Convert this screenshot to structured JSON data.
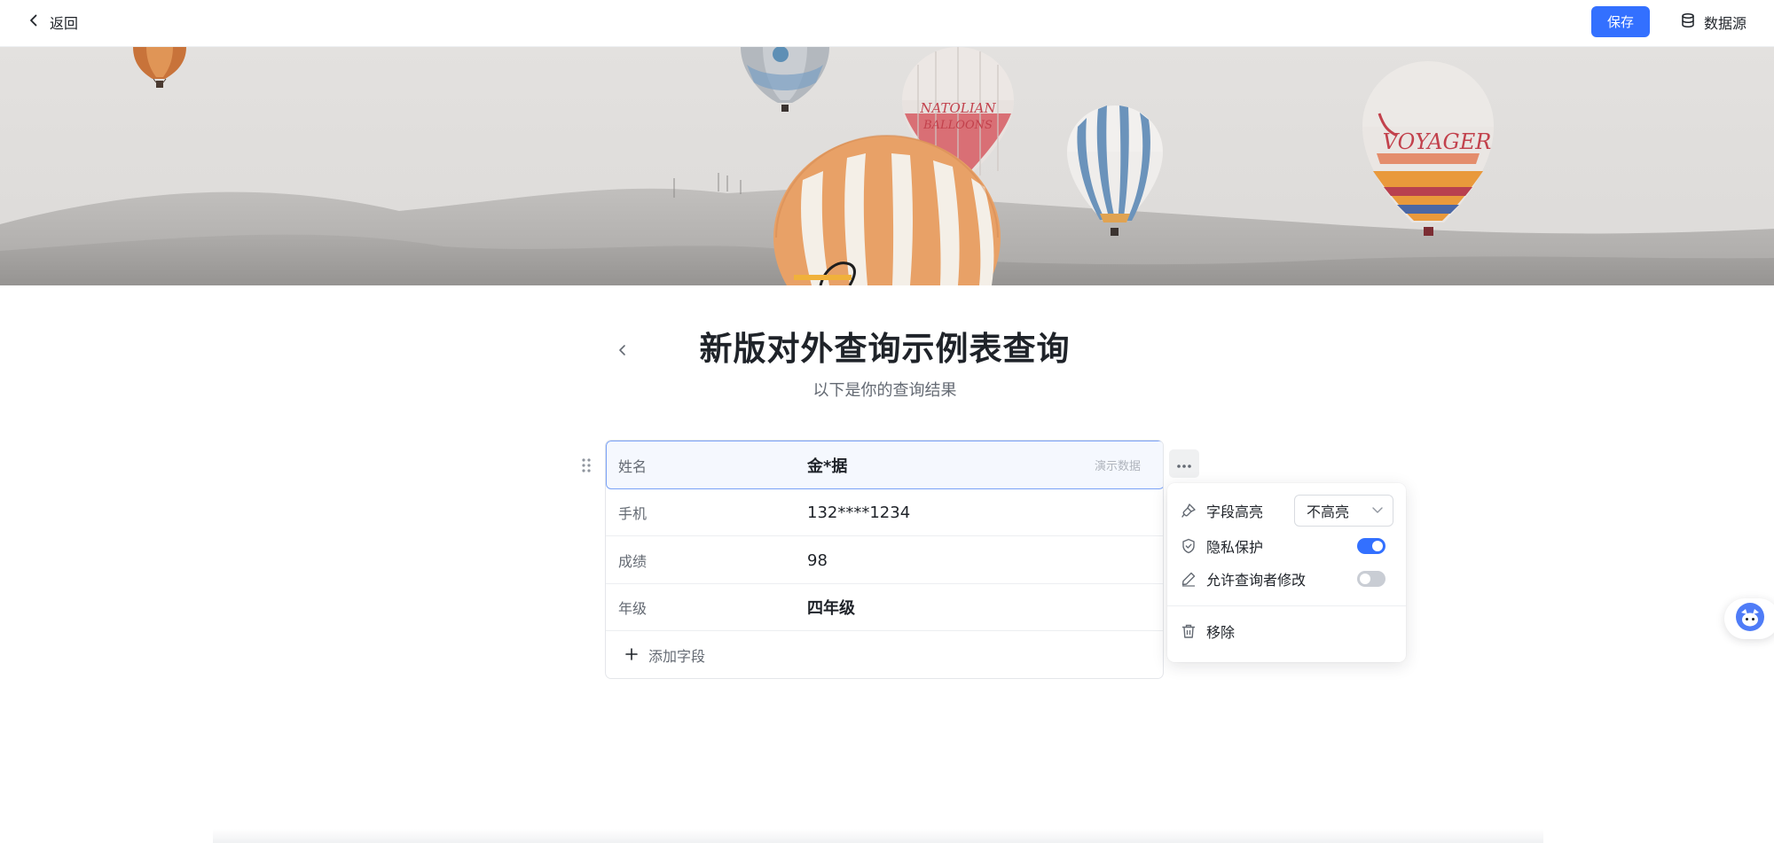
{
  "topbar": {
    "back_label": "返回",
    "save_label": "保存",
    "datasource_label": "数据源"
  },
  "banner": {
    "balloon_text_1": "NATOLIAN BALLOONS",
    "balloon_text_2": "VOYAGER"
  },
  "page": {
    "title": "新版对外查询示例表查询",
    "subtitle": "以下是你的查询结果"
  },
  "fields": [
    {
      "label": "姓名",
      "value": "金*据",
      "tag": "演示数据"
    },
    {
      "label": "手机",
      "value": "132****1234"
    },
    {
      "label": "成绩",
      "value": "98"
    },
    {
      "label": "年级",
      "value": "四年级"
    }
  ],
  "add_field_label": "添加字段",
  "popover": {
    "highlight_label": "字段高亮",
    "highlight_value": "不高亮",
    "privacy_label": "隐私保护",
    "privacy_on": true,
    "allow_edit_label": "允许查询者修改",
    "allow_edit_on": false,
    "remove_label": "移除"
  },
  "colors": {
    "accent": "#3370ff",
    "text": "#1f2329",
    "muted": "#646a73"
  }
}
